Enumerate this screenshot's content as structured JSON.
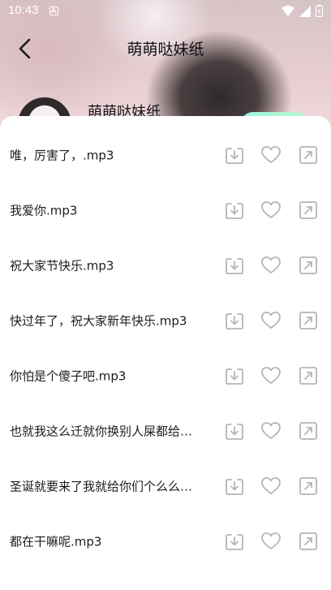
{
  "status": {
    "time": "10:43"
  },
  "header": {
    "title": "萌萌哒妹纸"
  },
  "profile": {
    "name": "萌萌哒妹纸"
  },
  "tracks": [
    {
      "title": "唯，厉害了，.mp3"
    },
    {
      "title": "我爱你.mp3"
    },
    {
      "title": "祝大家节快乐.mp3"
    },
    {
      "title": "快过年了，祝大家新年快乐.mp3"
    },
    {
      "title": "你怕是个傻子吧.mp3"
    },
    {
      "title": "也就我这么迁就你换别人屎都给…"
    },
    {
      "title": "圣诞就要来了我就给你们个么么…"
    },
    {
      "title": "都在干嘛呢.mp3"
    }
  ],
  "icons": {
    "download": "download-icon",
    "like": "heart-icon",
    "share": "share-icon"
  },
  "colors": {
    "icon": "#b5b5b5",
    "text": "#1c1c1c",
    "sheet": "#ffffff"
  }
}
